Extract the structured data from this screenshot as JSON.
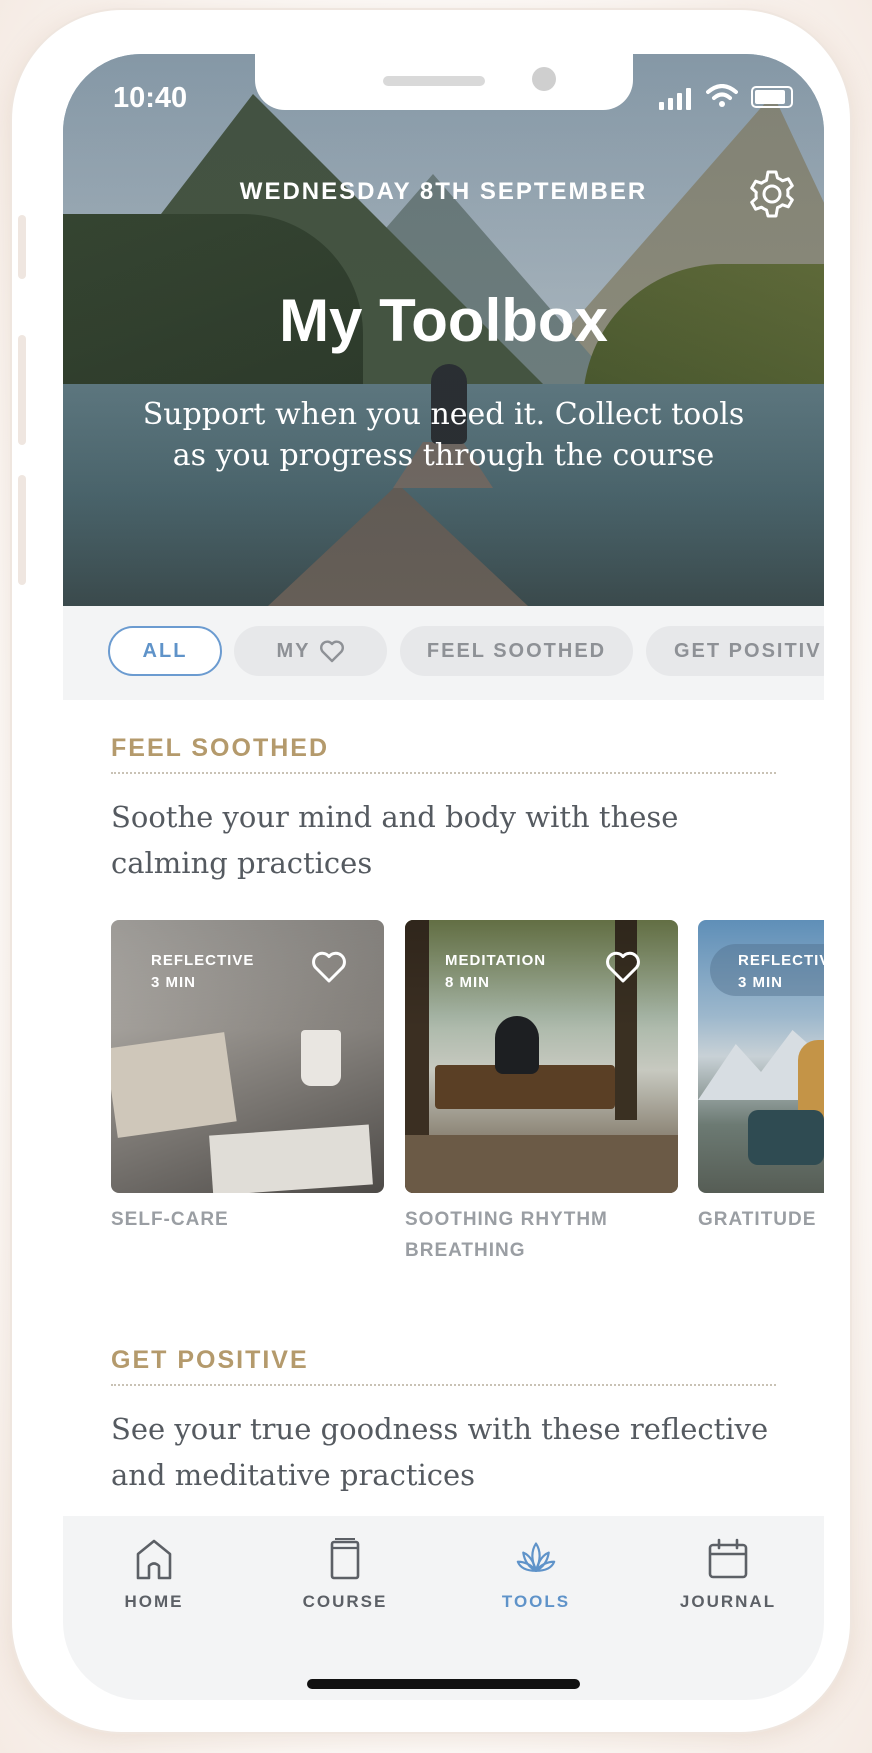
{
  "status": {
    "time": "10:40"
  },
  "header": {
    "date": "WEDNESDAY 8TH SEPTEMBER",
    "title": "My Toolbox",
    "subtitle": "Support when you need it. Collect tools as you progress through the course"
  },
  "filters": [
    {
      "label": "ALL",
      "active": true
    },
    {
      "label": "MY",
      "icon": "heart-icon",
      "active": false
    },
    {
      "label": "FEEL SOOTHED",
      "active": false
    },
    {
      "label": "GET POSITIV",
      "active": false
    }
  ],
  "sections": [
    {
      "title": "FEEL SOOTHED",
      "description": "Soothe your mind and body with these calming practices",
      "cards": [
        {
          "type": "REFLECTIVE",
          "duration": "3 MIN",
          "label": "SELF-CARE"
        },
        {
          "type": "MEDITATION",
          "duration": "8 MIN",
          "label": "SOOTHING RHYTHM BREATHING"
        },
        {
          "type": "REFLECTIV",
          "duration": "3 MIN",
          "label": "GRATITUDE"
        }
      ]
    },
    {
      "title": "GET POSITIVE",
      "description": "See your true goodness with these reflective and meditative practices"
    }
  ],
  "nav": [
    {
      "label": "HOME",
      "icon": "home-icon",
      "active": false
    },
    {
      "label": "COURSE",
      "icon": "book-icon",
      "active": false
    },
    {
      "label": "TOOLS",
      "icon": "lotus-icon",
      "active": true
    },
    {
      "label": "JOURNAL",
      "icon": "calendar-icon",
      "active": false
    }
  ],
  "colors": {
    "accent": "#5f93c9",
    "section_title": "#b49a6c",
    "nav_background": "#f3f4f5"
  }
}
